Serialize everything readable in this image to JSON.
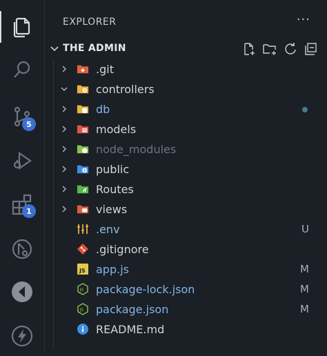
{
  "activity_bar": {
    "items": [
      {
        "icon": "files-icon",
        "active": true
      },
      {
        "icon": "search-icon"
      },
      {
        "icon": "source-control-icon",
        "badge": "5"
      },
      {
        "icon": "run-debug-icon"
      },
      {
        "icon": "extensions-icon",
        "badge": "1"
      },
      {
        "icon": "remote-explorer-icon"
      },
      {
        "icon": "live-share-icon"
      },
      {
        "icon": "thunder-icon"
      }
    ]
  },
  "explorer": {
    "header": "EXPLORER",
    "more": "···",
    "section_title": "THE ADMIN",
    "section_actions": [
      "new-file-icon",
      "new-folder-icon",
      "refresh-icon",
      "collapse-all-icon"
    ],
    "items": [
      {
        "name": ".git",
        "type": "folder",
        "expanded": false,
        "icon_color": "#e0633a",
        "style": "normal",
        "status": ""
      },
      {
        "name": "controllers",
        "type": "folder",
        "expanded": true,
        "icon_color": "#e6b53c",
        "style": "normal",
        "status": ""
      },
      {
        "name": "db",
        "type": "folder",
        "expanded": false,
        "icon_color": "#e6b53c",
        "style": "modified",
        "status": "dot"
      },
      {
        "name": "models",
        "type": "folder",
        "expanded": false,
        "icon_color": "#e0534a",
        "style": "normal",
        "status": ""
      },
      {
        "name": "node_modules",
        "type": "folder",
        "expanded": false,
        "icon_color": "#8bc34a",
        "style": "dim",
        "status": ""
      },
      {
        "name": "public",
        "type": "folder",
        "expanded": false,
        "icon_color": "#3d8fe0",
        "style": "normal",
        "status": ""
      },
      {
        "name": "Routes",
        "type": "folder",
        "expanded": false,
        "icon_color": "#58b84a",
        "style": "normal",
        "status": ""
      },
      {
        "name": "views",
        "type": "folder",
        "expanded": false,
        "icon_color": "#e05c3a",
        "style": "normal",
        "status": ""
      },
      {
        "name": ".env",
        "type": "file",
        "icon": "env-icon",
        "icon_color": "#e6b53c",
        "style": "added",
        "status": "U"
      },
      {
        "name": ".gitignore",
        "type": "file",
        "icon": "git-icon",
        "icon_color": "#e0533a",
        "style": "normal",
        "status": ""
      },
      {
        "name": "app.js",
        "type": "file",
        "icon": "js-icon",
        "icon_color": "#e6c84a",
        "style": "modified",
        "status": "M"
      },
      {
        "name": "package-lock.json",
        "type": "file",
        "icon": "nodejs-icon",
        "icon_color": "#8bc34a",
        "style": "modified",
        "status": "M"
      },
      {
        "name": "package.json",
        "type": "file",
        "icon": "nodejs-icon",
        "icon_color": "#8bc34a",
        "style": "modified",
        "status": "M"
      },
      {
        "name": "README.md",
        "type": "file",
        "icon": "info-icon",
        "icon_color": "#3d8fe0",
        "style": "normal",
        "status": ""
      }
    ]
  }
}
